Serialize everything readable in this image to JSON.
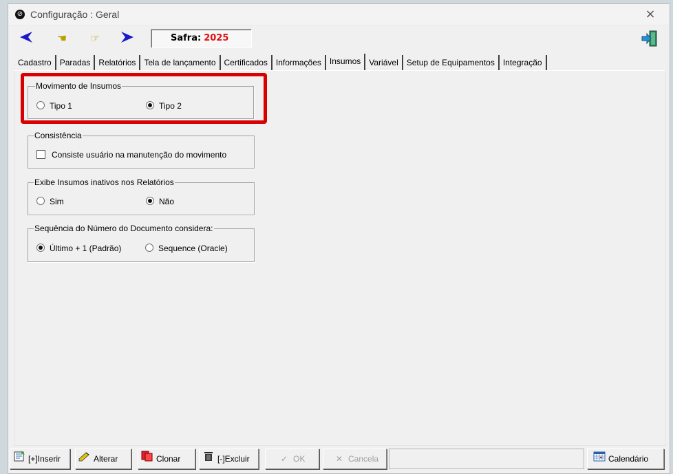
{
  "window": {
    "title": "Configuração : Geral",
    "close_glyph": "×"
  },
  "toolbar": {
    "prev_icon": "◀",
    "first_icon": "☚",
    "next_page_icon": "☞",
    "next_icon": "▶",
    "safra_label": "Safra:",
    "safra_value": "2025",
    "exit_icon": "exit-door-icon"
  },
  "tabs": [
    {
      "label": "Cadastro"
    },
    {
      "label": "Paradas"
    },
    {
      "label": "Relatórios"
    },
    {
      "label": "Tela de lançamento"
    },
    {
      "label": "Certificados"
    },
    {
      "label": "Informações"
    },
    {
      "label": "Insumos"
    },
    {
      "label": "Variável"
    },
    {
      "label": "Setup de Equipamentos"
    },
    {
      "label": "Integração"
    }
  ],
  "active_tab": "Insumos",
  "groups": {
    "movimento": {
      "legend": "Movimento de Insumos",
      "options": [
        {
          "label": "Tipo 1",
          "checked": false
        },
        {
          "label": "Tipo 2",
          "checked": true
        }
      ]
    },
    "consistencia": {
      "legend": "Consistência",
      "checkbox_label": "Consiste usuário na manutenção do movimento",
      "checked": false
    },
    "inativos": {
      "legend": "Exibe Insumos inativos nos Relatórios",
      "options": [
        {
          "label": "Sim",
          "checked": false
        },
        {
          "label": "Não",
          "checked": true
        }
      ]
    },
    "sequencia": {
      "legend": "Sequência do Número do Documento considera:",
      "options": [
        {
          "label": "Último + 1 (Padrão)",
          "checked": true
        },
        {
          "label": "Sequence (Oracle)",
          "checked": false
        }
      ]
    }
  },
  "highlight_color": "#d80000",
  "bottom_buttons": {
    "inserir": "[+]Inserir",
    "alterar": "Alterar",
    "clonar": "Clonar",
    "excluir": "[-]Excluir",
    "ok": "OK",
    "cancela": "Cancela",
    "calendario": "Calendário"
  }
}
